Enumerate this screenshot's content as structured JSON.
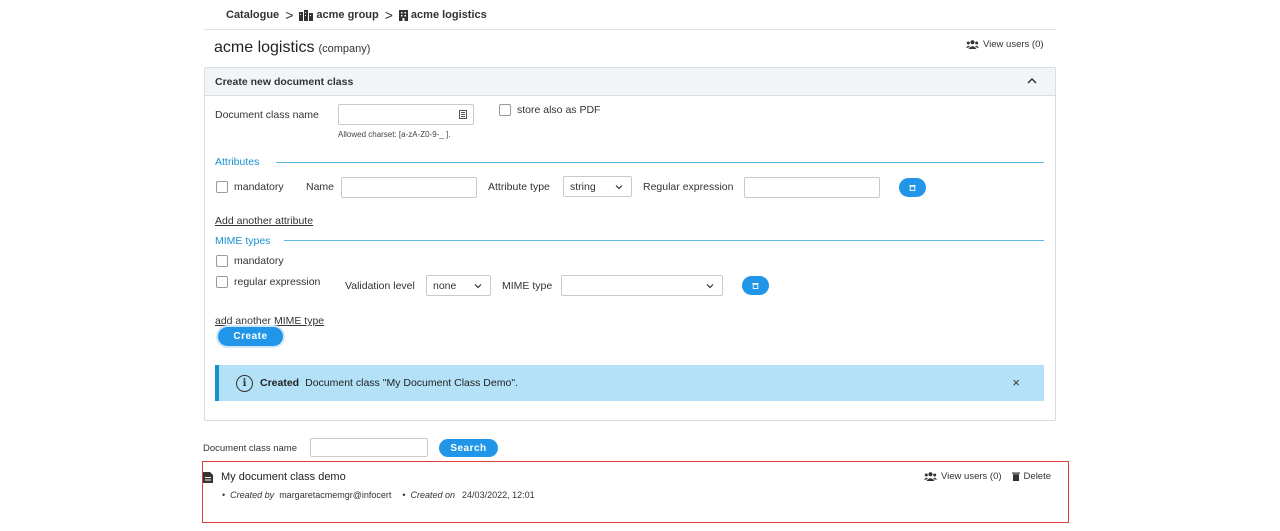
{
  "breadcrumb": {
    "items": [
      "Catalogue",
      "acme group",
      "acme logistics"
    ],
    "separator": ">"
  },
  "header": {
    "title": "acme logistics",
    "subtype": "(company)",
    "view_users": "View users (0)"
  },
  "form": {
    "title": "Create new document class",
    "doc_class_name_label": "Document class name",
    "doc_class_name_value": "",
    "allowed_charset": "Allowed charset: [a-zA-Z0-9-_ ].",
    "store_pdf_label": "store also as PDF",
    "attributes": {
      "section_title": "Attributes",
      "mandatory_label": "mandatory",
      "name_label": "Name",
      "attribute_type_label": "Attribute type",
      "attribute_type_value": "string",
      "regex_label": "Regular expression",
      "add_another": "Add another attribute"
    },
    "mime": {
      "section_title": "MIME types",
      "mandatory_label": "mandatory",
      "regex_label": "regular expression",
      "validation_level_label": "Validation level",
      "validation_level_value": "none",
      "mime_type_label": "MIME type",
      "mime_type_value": "",
      "add_another": "add another MIME type"
    },
    "create_label": "Create"
  },
  "alert": {
    "strong": "Created",
    "message": "Document class \"My Document Class Demo\".",
    "close": "×",
    "info_glyph": "i"
  },
  "search": {
    "label": "Document class name",
    "value": "",
    "button": "Search"
  },
  "result": {
    "name": "My document class demo",
    "created_by_label": "Created by",
    "created_by": "margaretacmemgr@infocert",
    "created_on_label": "Created on",
    "created_on": "24/03/2022, 12:01",
    "bullet": "•",
    "view_users": "View users (0)",
    "delete": "Delete"
  },
  "colors": {
    "accent": "#2196e8",
    "section": "#1a8fcf",
    "alert_bg": "#b3e1f7",
    "highlight_border": "#e23c3c"
  }
}
